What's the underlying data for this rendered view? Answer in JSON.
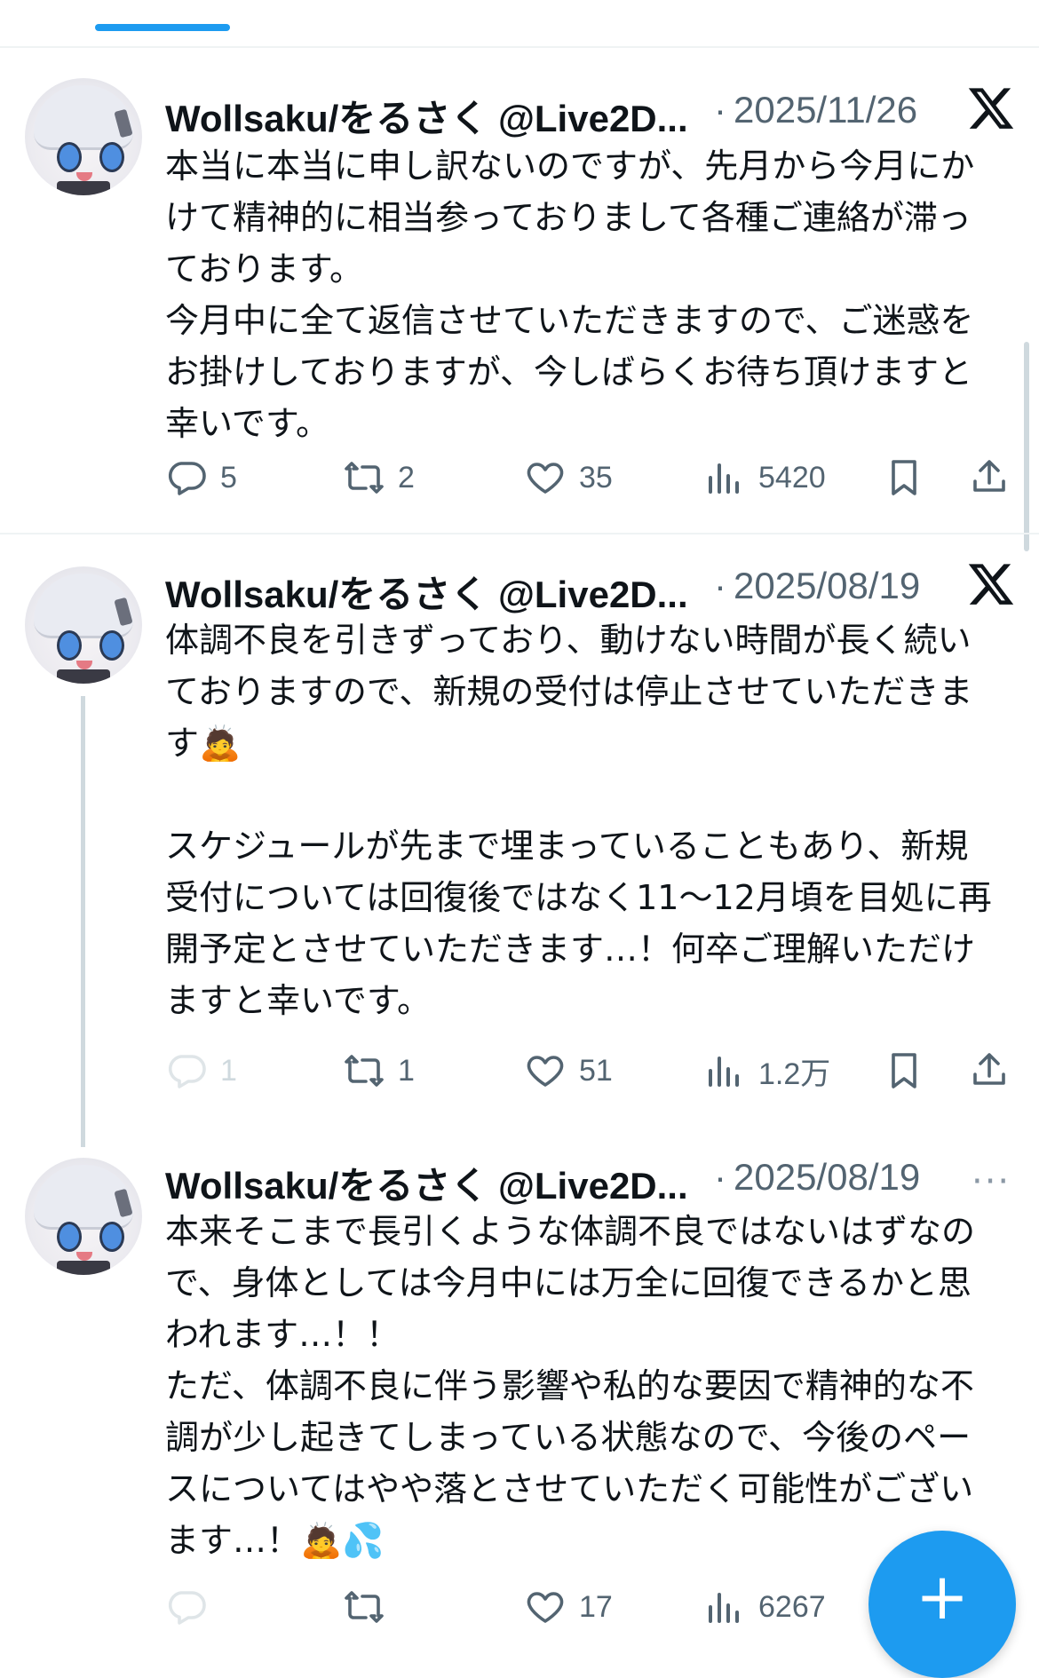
{
  "tweets": [
    {
      "author": "Wollsaku/をるさく @Live2D...",
      "separator": "·",
      "date": "2025/11/26",
      "text": "本当に本当に申し訳ないのですが、先月から今月にかけて精神的に相当参っておりまして各種ご連絡が滞っております。\n今月中に全て返信させていただきますので、ご迷惑をお掛けしておりますが、今しばらくお待ち頂けますと幸いです。",
      "replies": "5",
      "reposts": "2",
      "likes": "35",
      "views": "5420"
    },
    {
      "author": "Wollsaku/をるさく @Live2D...",
      "separator": "·",
      "date": "2025/08/19",
      "text": "体調不良を引きずっており、動けない時間が長く続いておりますので、新規の受付は停止させていただきます🙇\n\nスケジュールが先まで埋まっていることもあり、新規受付については回復後ではなく11〜12月頃を目処に再開予定とさせていただきます…！何卒ご理解いただけますと幸いです。",
      "replies": "1",
      "reposts": "1",
      "likes": "51",
      "views": "1.2万"
    },
    {
      "author": "Wollsaku/をるさく @Live2D...",
      "separator": "·",
      "date": "2025/08/19",
      "more_label": "···",
      "text": "本来そこまで長引くような体調不良ではないはずなので、身体としては今月中には万全に回復できるかと思われます…！！\nただ、体調不良に伴う影響や私的な要因で精神的な不調が少し起きてしまっている状態なので、今後のペースについてはやや落とさせていただく可能性がございます…！🙇💦",
      "reposts": "",
      "likes": "17",
      "views": "6267"
    }
  ],
  "fab": {
    "label": "+"
  },
  "colors": {
    "accent": "#1d9bf0",
    "secondary_text": "#536471",
    "divider": "#eff3f4"
  },
  "icons": [
    "reply-icon",
    "repost-icon",
    "like-icon",
    "views-icon",
    "bookmark-icon",
    "share-icon",
    "x-logo-icon",
    "more-icon"
  ]
}
